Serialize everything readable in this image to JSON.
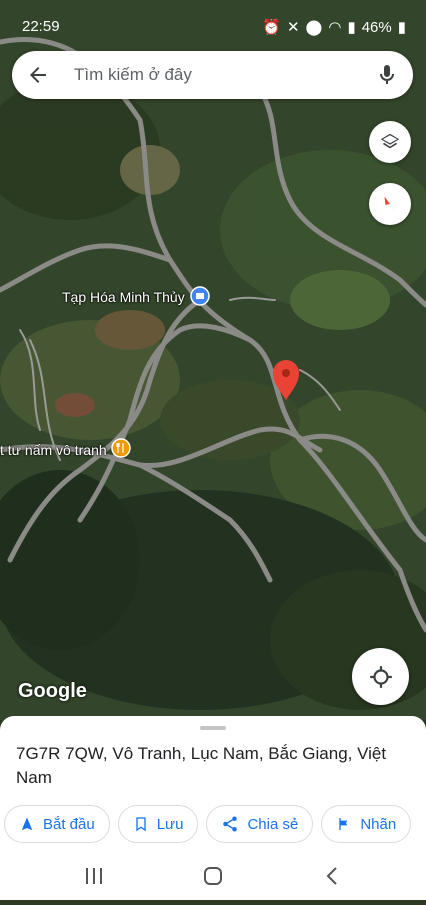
{
  "status": {
    "time": "22:59",
    "battery": "46%"
  },
  "search": {
    "placeholder": "Tìm kiếm ở đây"
  },
  "map": {
    "labels": {
      "shop": "Tạp Hóa Minh Thủy",
      "restaurant": "t tư nấm vô tranh"
    },
    "attribution": "Google"
  },
  "sheet": {
    "address": "7G7R 7QW, Vô Tranh, Lục Nam, Bắc Giang, Việt Nam",
    "actions": {
      "start": "Bắt đầu",
      "save": "Lưu",
      "share": "Chia sẻ",
      "label": "Nhãn"
    }
  },
  "colors": {
    "accent": "#1a73e8",
    "pin": "#ea4335"
  }
}
